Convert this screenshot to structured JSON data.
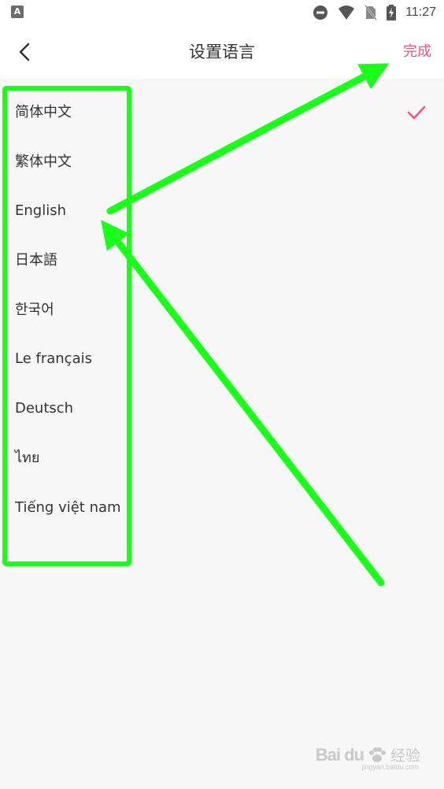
{
  "status_bar": {
    "app_icon": "A",
    "time": "11:27",
    "icons": [
      "do-not-disturb-icon",
      "wifi-icon",
      "no-sim-icon",
      "battery-charging-icon"
    ]
  },
  "header": {
    "back_icon": "chevron-left-icon",
    "title": "设置语言",
    "done_label": "完成"
  },
  "languages": [
    {
      "label": "简体中文",
      "selected": true
    },
    {
      "label": "繁体中文",
      "selected": false
    },
    {
      "label": "English",
      "selected": false
    },
    {
      "label": "日本語",
      "selected": false
    },
    {
      "label": "한국어",
      "selected": false
    },
    {
      "label": "Le français",
      "selected": false
    },
    {
      "label": "Deutsch",
      "selected": false
    },
    {
      "label": "ไทย",
      "selected": false
    },
    {
      "label": "Tiếng việt nam",
      "selected": false
    }
  ],
  "colors": {
    "accent": "#f0527e",
    "annotation": "#1aff1a",
    "background": "#f7f7f7"
  },
  "watermark": {
    "brand": "Bai du",
    "suffix": "经验",
    "url": "jingyan.baidu.com"
  }
}
